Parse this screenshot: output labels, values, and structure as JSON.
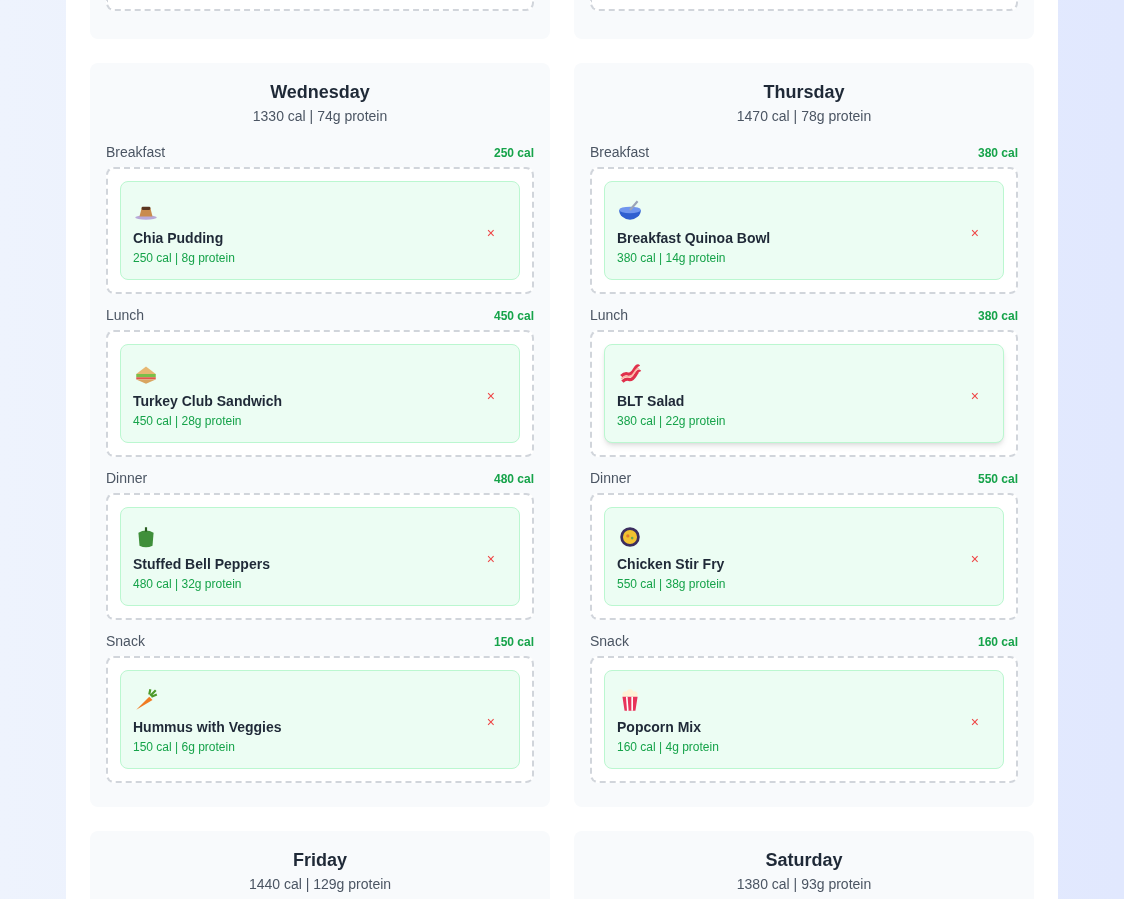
{
  "days": [
    {
      "name": "Wednesday",
      "summary": "1330 cal | 74g protein",
      "slots": [
        {
          "label": "Breakfast",
          "calories": "250 cal",
          "meals": [
            {
              "kind": "pudding",
              "name": "Chia Pudding",
              "info": "250 cal | 8g protein",
              "remove": "×",
              "hovered": false
            }
          ]
        },
        {
          "label": "Lunch",
          "calories": "450 cal",
          "meals": [
            {
              "kind": "sandwich",
              "name": "Turkey Club Sandwich",
              "info": "450 cal | 28g protein",
              "remove": "×",
              "hovered": false
            }
          ]
        },
        {
          "label": "Dinner",
          "calories": "480 cal",
          "meals": [
            {
              "kind": "pepper",
              "name": "Stuffed Bell Peppers",
              "info": "480 cal | 32g protein",
              "remove": "×",
              "hovered": false
            }
          ]
        },
        {
          "label": "Snack",
          "calories": "150 cal",
          "meals": [
            {
              "kind": "carrot",
              "name": "Hummus with Veggies",
              "info": "150 cal | 6g protein",
              "remove": "×",
              "hovered": false
            }
          ]
        }
      ]
    },
    {
      "name": "Thursday",
      "summary": "1470 cal | 78g protein",
      "slots": [
        {
          "label": "Breakfast",
          "calories": "380 cal",
          "meals": [
            {
              "kind": "bowl",
              "name": "Breakfast Quinoa Bowl",
              "info": "380 cal | 14g protein",
              "remove": "×",
              "hovered": false
            }
          ]
        },
        {
          "label": "Lunch",
          "calories": "380 cal",
          "meals": [
            {
              "kind": "bacon",
              "name": "BLT Salad",
              "info": "380 cal | 22g protein",
              "remove": "×",
              "hovered": true
            }
          ]
        },
        {
          "label": "Dinner",
          "calories": "550 cal",
          "meals": [
            {
              "kind": "pan",
              "name": "Chicken Stir Fry",
              "info": "550 cal | 38g protein",
              "remove": "×",
              "hovered": false
            }
          ]
        },
        {
          "label": "Snack",
          "calories": "160 cal",
          "meals": [
            {
              "kind": "popcorn",
              "name": "Popcorn Mix",
              "info": "160 cal | 4g protein",
              "remove": "×",
              "hovered": false
            }
          ]
        }
      ]
    },
    {
      "name": "Friday",
      "summary": "1440 cal | 129g protein"
    },
    {
      "name": "Saturday",
      "summary": "1380 cal | 93g protein"
    }
  ]
}
